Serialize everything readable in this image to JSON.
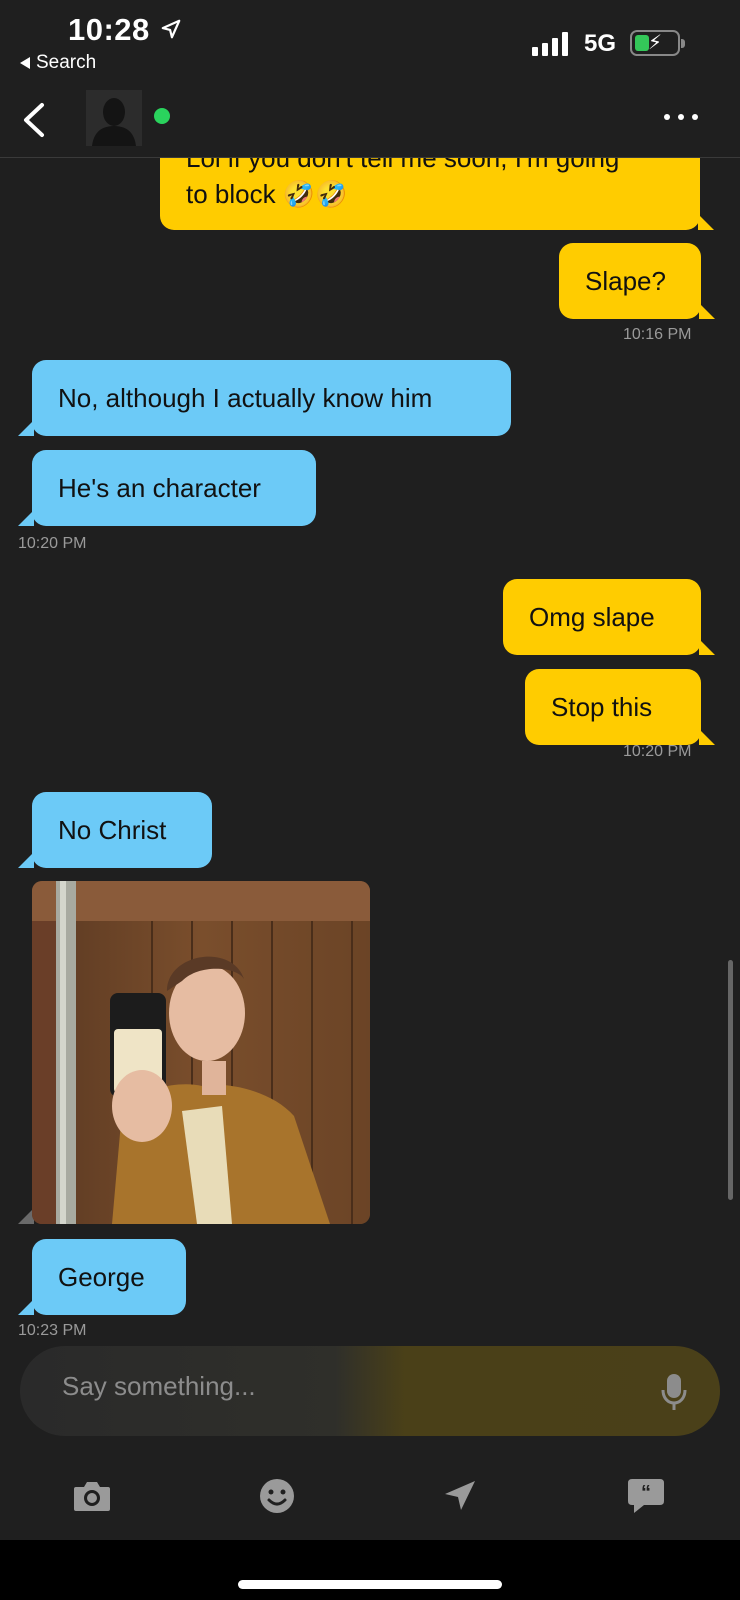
{
  "status_bar": {
    "time": "10:28",
    "back_app": "Search",
    "network": "5G"
  },
  "header": {
    "avatar_icon": "person-silhouette-icon",
    "online": true,
    "menu_icon": "more-icon"
  },
  "messages": [
    {
      "dir": "out",
      "text": "Lol if you don't tell me soon, I'm going",
      "partial": true
    },
    {
      "dir": "out",
      "text": "to block 🤣🤣"
    },
    {
      "dir": "out",
      "text": "Slape?"
    },
    {
      "type": "timestamp",
      "text": "10:16 PM"
    },
    {
      "dir": "in",
      "text": "No, although I actually know him"
    },
    {
      "dir": "in",
      "text": "He's an character"
    },
    {
      "type": "timestamp",
      "text": "10:20 PM"
    },
    {
      "dir": "out",
      "text": "Omg slape"
    },
    {
      "dir": "out",
      "text": "Stop this"
    },
    {
      "type": "timestamp",
      "text": "10:20 PM"
    },
    {
      "dir": "in",
      "text": "No Christ"
    },
    {
      "dir": "in",
      "type": "photo"
    },
    {
      "dir": "in",
      "text": "George"
    },
    {
      "type": "timestamp",
      "text": "10:23 PM"
    }
  ],
  "composer": {
    "placeholder": "Say something...",
    "mic_icon": "microphone-icon"
  },
  "toolbar": [
    "camera-icon",
    "emoji-icon",
    "location-icon",
    "quick-reply-icon"
  ],
  "colors": {
    "outgoing": "#ffcc00",
    "incoming": "#6ccaf7",
    "background": "#1f1f1f",
    "online": "#2ad35d"
  }
}
